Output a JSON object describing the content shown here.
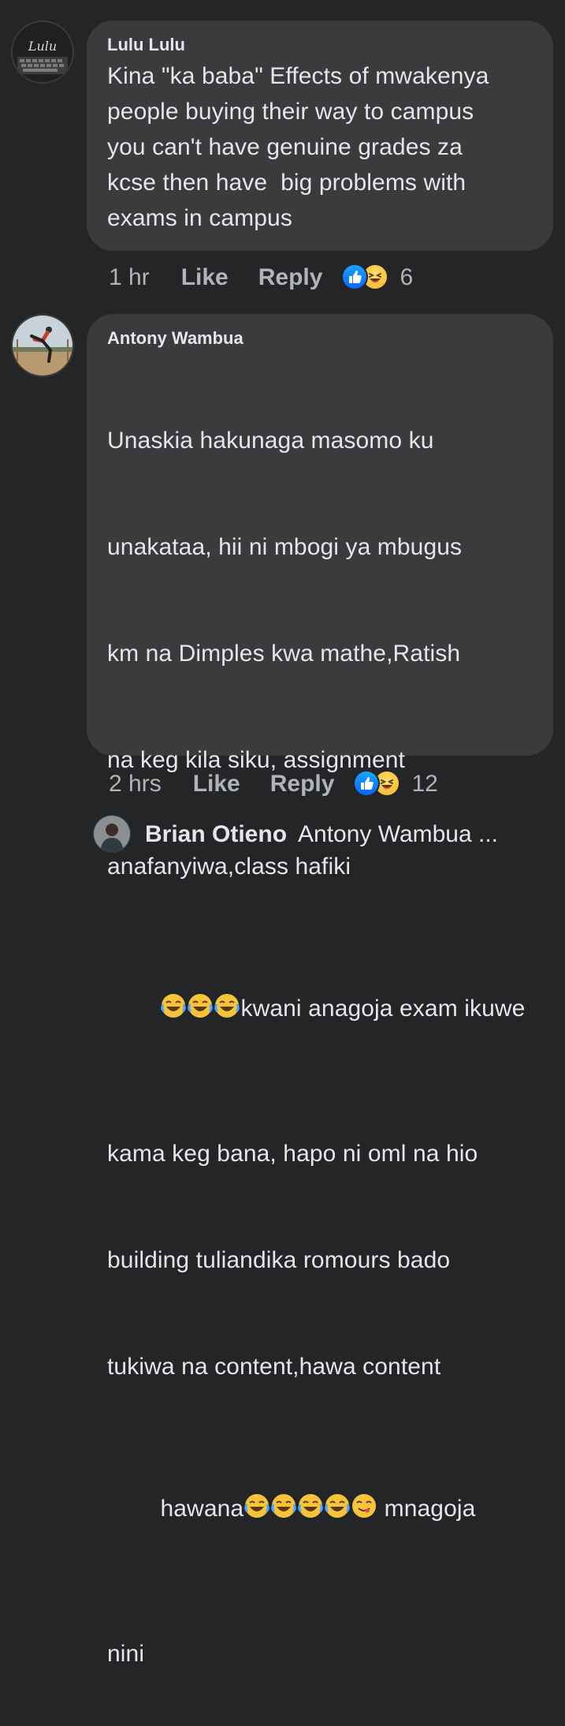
{
  "comments": [
    {
      "author": "Lulu Lulu",
      "text": "Kina \"ka baba\" Effects of mwakenya\npeople buying their way to campus\nyou can't have genuine grades za\nkcse then have  big problems with\nexams in campus",
      "time": "1 hr",
      "like_label": "Like",
      "reply_label": "Reply",
      "reaction_count": "6",
      "avatar_text": "Lulu"
    },
    {
      "author": "Antony Wambua",
      "lines": [
        "Unaskia hakunaga masomo ku",
        "unakataa, hii ni mbogi ya mbugus",
        "km na Dimples kwa mathe,Ratish",
        "na keg kila siku, assignment",
        "anafanyiwa,class hafiki",
        "kwani anagoja exam ikuwe",
        "kama keg bana, hapo ni oml na hio",
        "building tuliandika romours bado",
        "tukiwa na content,hawa content",
        "hawana",
        " mnagoja",
        "nini"
      ],
      "time": "2 hrs",
      "like_label": "Like",
      "reply_label": "Reply",
      "reaction_count": "12"
    }
  ],
  "reply_preview": {
    "author": "Brian Otieno",
    "text": "Antony Wambua ..."
  },
  "colors": {
    "background": "#242526",
    "bubble": "#3a3b3c",
    "text": "#e4e6eb",
    "muted": "#b0b3b8",
    "like_blue": "#0866ff",
    "haha_yellow": "#f7b125"
  }
}
